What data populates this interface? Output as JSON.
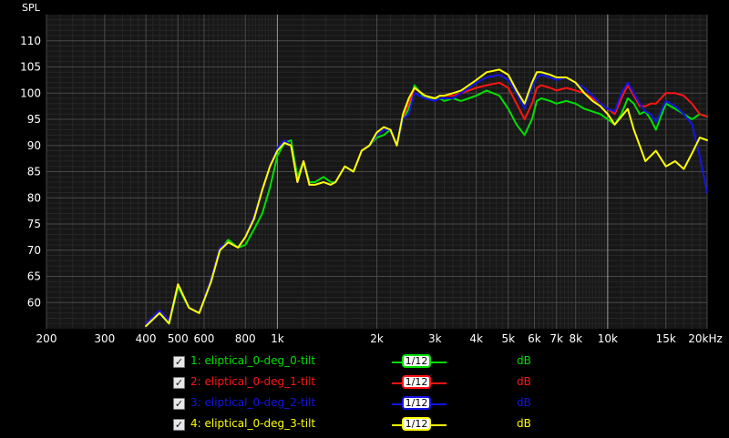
{
  "chart_data": {
    "type": "line",
    "xscale": "log",
    "xlim": [
      200,
      20000
    ],
    "ylim": [
      55,
      115
    ],
    "ylabel": "SPL",
    "grid": true,
    "y_ticks": [
      60,
      65,
      70,
      75,
      80,
      85,
      90,
      95,
      100,
      105,
      110
    ],
    "y_tick_labels": [
      "60",
      "65",
      "70",
      "75",
      "80",
      "85",
      "90",
      "95",
      "100",
      "105",
      "110"
    ],
    "x_ticks": [
      200,
      300,
      400,
      500,
      600,
      800,
      1000,
      2000,
      3000,
      4000,
      5000,
      6000,
      7000,
      8000,
      10000,
      15000,
      20000
    ],
    "x_tick_labels": [
      "200",
      "300",
      "400",
      "500",
      "600",
      "800",
      "1k",
      "2k",
      "3k",
      "4k",
      "5k",
      "6k",
      "7k",
      "8k",
      "10k",
      "15k",
      "20kHz"
    ],
    "series": [
      {
        "name": "1: eliptical_0-deg_0-tilt",
        "color": "#00e000",
        "x": [
          400,
          440,
          470,
          500,
          540,
          580,
          630,
          670,
          710,
          760,
          800,
          850,
          900,
          950,
          1000,
          1050,
          1100,
          1150,
          1200,
          1250,
          1300,
          1380,
          1450,
          1500,
          1600,
          1700,
          1800,
          1900,
          2000,
          2100,
          2200,
          2300,
          2400,
          2500,
          2600,
          2800,
          3000,
          3100,
          3200,
          3400,
          3600,
          3800,
          4000,
          4300,
          4700,
          5000,
          5300,
          5600,
          5900,
          6100,
          6300,
          6700,
          7000,
          7500,
          8000,
          8500,
          9000,
          9500,
          10000,
          10500,
          11000,
          11500,
          12000,
          12500,
          13000,
          13500,
          14000,
          15000,
          16000,
          17000,
          18000,
          19000,
          20000
        ],
        "y": [
          56,
          58,
          56,
          63,
          59,
          58,
          64,
          70,
          72,
          70.5,
          71,
          74,
          77,
          82,
          88,
          90.5,
          91,
          84,
          87,
          83,
          83,
          84,
          83,
          83,
          86,
          85,
          89,
          90,
          91.5,
          92,
          93,
          90,
          95,
          97,
          101.5,
          99,
          99,
          99,
          98.5,
          99,
          98.5,
          99,
          99.5,
          100.5,
          99.5,
          97,
          94,
          92,
          95,
          98.5,
          99,
          98.5,
          98,
          98.5,
          98,
          97,
          96.5,
          96,
          95,
          94,
          96,
          99,
          98,
          96,
          96.5,
          95,
          93,
          98,
          97,
          96,
          95,
          96,
          95.5
        ]
      },
      {
        "name": "2: eliptical_0-deg_1-tilt",
        "color": "#ff1414",
        "x": [
          400,
          440,
          470,
          500,
          540,
          580,
          630,
          670,
          710,
          760,
          800,
          850,
          900,
          950,
          1000,
          1050,
          1100,
          1150,
          1200,
          1250,
          1300,
          1380,
          1450,
          1500,
          1600,
          1700,
          1800,
          1900,
          2000,
          2100,
          2200,
          2300,
          2400,
          2500,
          2600,
          2800,
          3000,
          3100,
          3200,
          3400,
          3600,
          3800,
          4000,
          4300,
          4700,
          5000,
          5300,
          5600,
          5900,
          6100,
          6300,
          6700,
          7000,
          7500,
          8000,
          8500,
          9000,
          9500,
          10000,
          10500,
          11000,
          11500,
          12000,
          12500,
          13000,
          13500,
          14000,
          15000,
          16000,
          17000,
          18000,
          19000,
          20000
        ],
        "y": [
          56,
          58.5,
          56.5,
          63.5,
          59,
          58,
          64.5,
          70.5,
          71.5,
          70.5,
          72.5,
          76.5,
          81.5,
          86,
          89.5,
          91,
          90,
          83,
          87,
          82.5,
          82.5,
          83,
          82.5,
          83,
          86,
          85,
          89,
          90,
          92,
          93,
          93,
          90,
          95.5,
          98,
          101,
          99.5,
          99,
          99.5,
          99.5,
          99.5,
          100,
          100.5,
          101,
          101.5,
          102,
          101,
          98,
          95,
          98,
          101,
          101.5,
          101,
          100.5,
          101,
          100.5,
          100,
          99,
          98,
          97,
          96,
          99,
          101.5,
          99.5,
          97.5,
          97.5,
          98,
          98,
          100,
          100,
          99.5,
          98,
          96,
          95.5
        ]
      },
      {
        "name": "3: eliptical_0-deg_2-tilt",
        "color": "#1414e6",
        "x": [
          400,
          440,
          470,
          500,
          540,
          580,
          630,
          670,
          710,
          760,
          800,
          850,
          900,
          950,
          1000,
          1050,
          1100,
          1150,
          1200,
          1250,
          1300,
          1380,
          1450,
          1500,
          1600,
          1700,
          1800,
          1900,
          2000,
          2100,
          2200,
          2300,
          2400,
          2500,
          2600,
          2800,
          3000,
          3100,
          3200,
          3400,
          3600,
          3800,
          4000,
          4300,
          4700,
          5000,
          5300,
          5600,
          5900,
          6100,
          6300,
          6700,
          7000,
          7500,
          8000,
          8500,
          9000,
          9500,
          10000,
          10500,
          11000,
          11500,
          12000,
          12500,
          13000,
          13500,
          14000,
          15000,
          16000,
          17000,
          18000,
          19000,
          20000
        ],
        "y": [
          56,
          58.5,
          56.5,
          63.5,
          59,
          58,
          64.5,
          70.5,
          71.5,
          70.5,
          72.5,
          76.5,
          81.5,
          86,
          89.5,
          91,
          90,
          83,
          87,
          82.5,
          82.5,
          83,
          82.5,
          83,
          86,
          85,
          89,
          90,
          92,
          93,
          93,
          90,
          95,
          96,
          100,
          99,
          98.5,
          99,
          99,
          99,
          100,
          101,
          102,
          103,
          103.5,
          102.5,
          100,
          97,
          101,
          103,
          103.5,
          103,
          102.5,
          103,
          102,
          101,
          99.5,
          98,
          97,
          96.5,
          100,
          102,
          100,
          98,
          96.5,
          96,
          94.5,
          98.5,
          97.5,
          96,
          94,
          88,
          81
        ]
      },
      {
        "name": "4: eliptical_0-deg_3-tilt",
        "color": "#ffff00",
        "x": [
          400,
          440,
          470,
          500,
          540,
          580,
          630,
          670,
          710,
          760,
          800,
          850,
          900,
          950,
          1000,
          1050,
          1100,
          1150,
          1200,
          1250,
          1300,
          1380,
          1450,
          1500,
          1600,
          1700,
          1800,
          1900,
          2000,
          2100,
          2200,
          2300,
          2400,
          2500,
          2600,
          2800,
          3000,
          3100,
          3200,
          3400,
          3600,
          3800,
          4000,
          4300,
          4700,
          5000,
          5300,
          5600,
          5900,
          6100,
          6300,
          6700,
          7000,
          7500,
          8000,
          8500,
          9000,
          9500,
          10000,
          10500,
          11000,
          11500,
          12000,
          12500,
          13000,
          13500,
          14000,
          15000,
          16000,
          17000,
          18000,
          19000,
          20000
        ],
        "y": [
          55.5,
          58,
          56,
          63.5,
          59,
          58,
          64,
          70,
          71.5,
          70.5,
          72.5,
          76,
          81.5,
          86,
          89,
          90.5,
          90,
          83,
          87,
          82.5,
          82.5,
          83,
          82.5,
          83,
          86,
          85,
          89,
          90,
          92.5,
          93.5,
          93,
          90,
          96,
          99,
          101,
          99.5,
          99,
          99.5,
          99.5,
          100,
          100.5,
          101.5,
          102.5,
          104,
          104.5,
          103.5,
          100.5,
          98,
          102,
          104,
          104,
          103.5,
          103,
          103,
          102,
          100,
          98.5,
          97.5,
          96,
          94,
          95.5,
          97,
          93,
          90,
          87,
          88,
          89,
          86,
          87,
          85.5,
          88.5,
          91.5,
          91
        ]
      }
    ]
  },
  "legend": [
    {
      "checked": "✓",
      "label": "1: eliptical_0-deg_0-tilt",
      "smoothing": "1/12",
      "unit": "dB",
      "color": "#00e000"
    },
    {
      "checked": "✓",
      "label": "2: eliptical_0-deg_1-tilt",
      "smoothing": "1/12",
      "unit": "dB",
      "color": "#ff1414"
    },
    {
      "checked": "✓",
      "label": "3: eliptical_0-deg_2-tilt",
      "smoothing": "1/12",
      "unit": "dB",
      "color": "#1414e6"
    },
    {
      "checked": "✓",
      "label": "4: eliptical_0-deg_3-tilt",
      "smoothing": "1/12",
      "unit": "dB",
      "color": "#ffff00"
    }
  ]
}
